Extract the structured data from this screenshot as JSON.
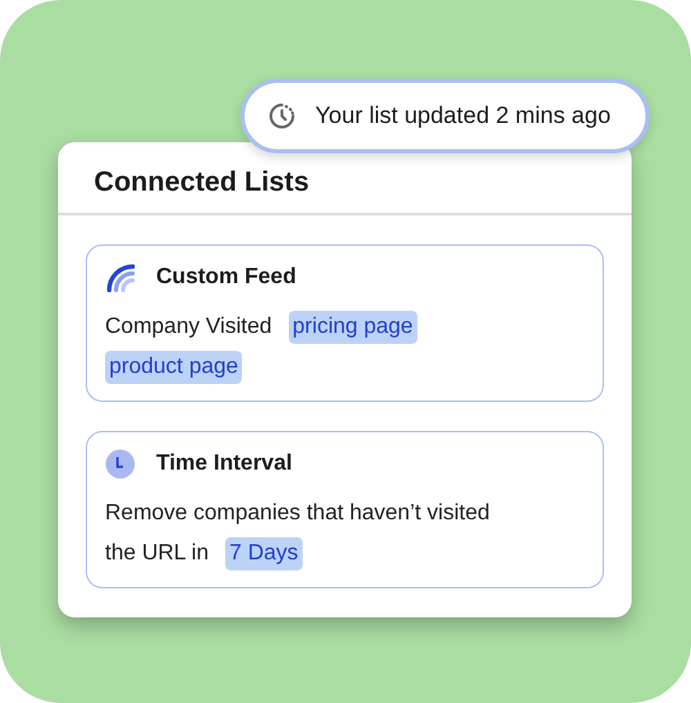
{
  "toast": {
    "text": "Your list updated 2 mins ago"
  },
  "panel": {
    "title": "Connected Lists",
    "lists": [
      {
        "kind": "feed",
        "title": "Custom Feed",
        "lines": [
          [
            {
              "kind": "text",
              "text": "Company Visited"
            },
            {
              "kind": "tag",
              "text": "pricing page"
            }
          ],
          [
            {
              "kind": "tag",
              "text": "product page"
            }
          ]
        ]
      },
      {
        "kind": "interval",
        "title": "Time Interval",
        "lines": [
          [
            {
              "kind": "text",
              "text": "Remove companies that haven’t visited"
            }
          ],
          [
            {
              "kind": "text",
              "text": "the URL in"
            },
            {
              "kind": "tag",
              "text": "7 Days"
            }
          ]
        ]
      }
    ]
  }
}
